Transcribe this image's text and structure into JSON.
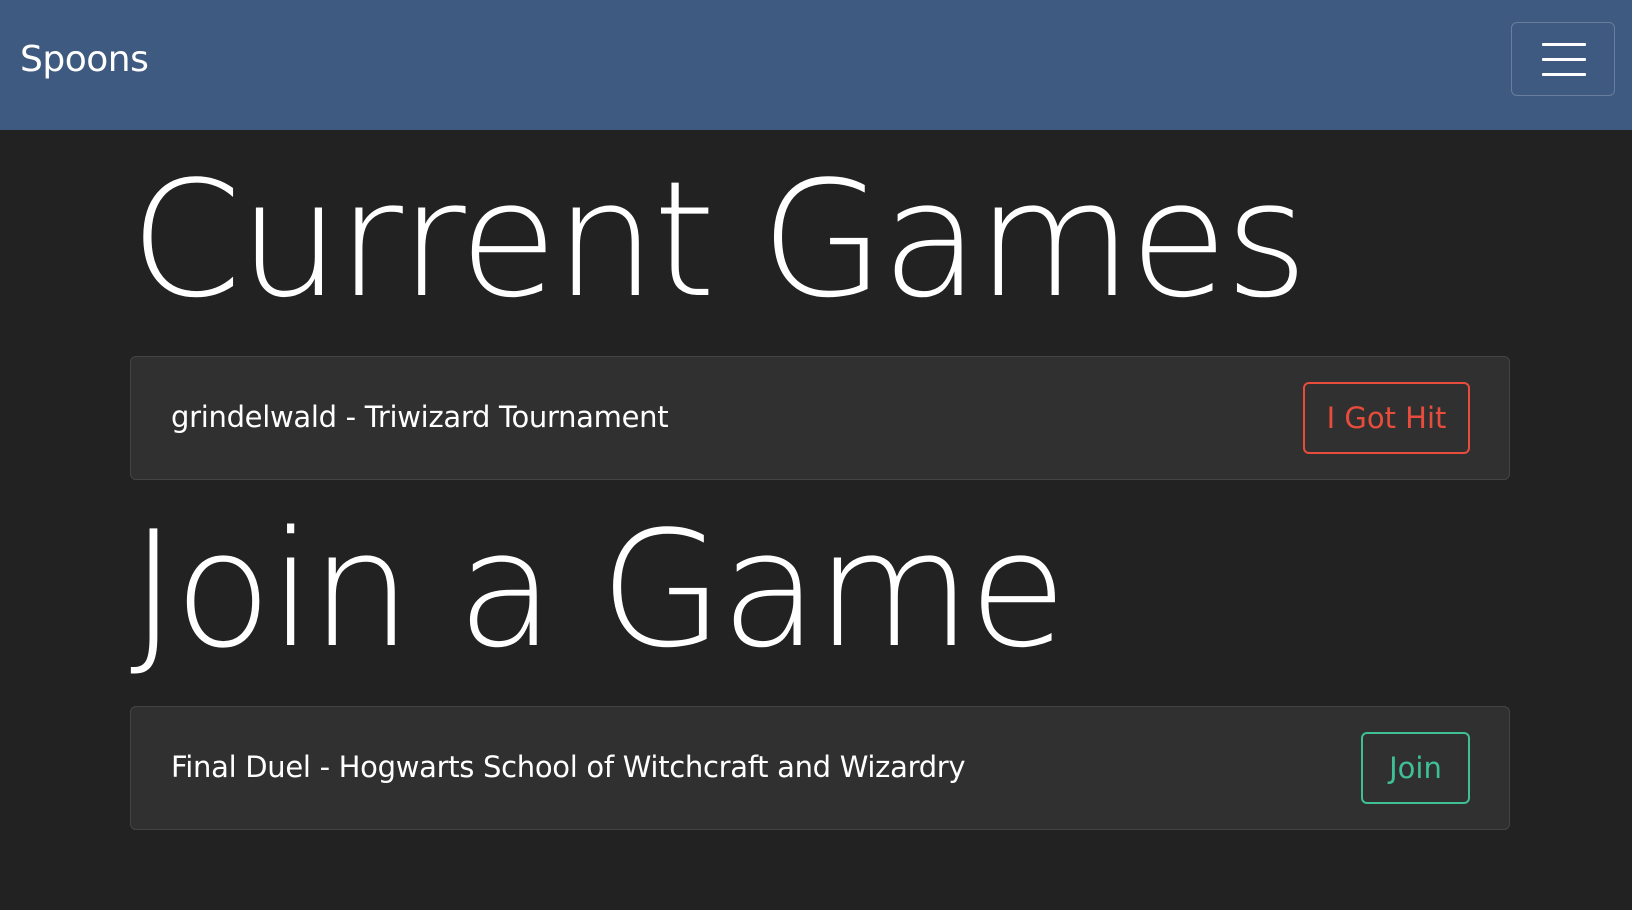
{
  "navbar": {
    "brand": "Spoons",
    "toggler_icon": "hamburger-menu-icon"
  },
  "colors": {
    "navbar_bg": "#3e5a80",
    "page_bg": "#222222",
    "card_bg": "#303030",
    "danger": "#e74c3c",
    "success": "#3fbf96"
  },
  "current_games": {
    "heading": "Current Games",
    "items": [
      {
        "label": "grindelwald - Triwizard Tournament",
        "action": "I Got Hit"
      }
    ]
  },
  "join_game": {
    "heading": "Join a Game",
    "items": [
      {
        "label": "Final Duel - Hogwarts School of Witchcraft and Wizardry",
        "action": "Join"
      }
    ]
  }
}
